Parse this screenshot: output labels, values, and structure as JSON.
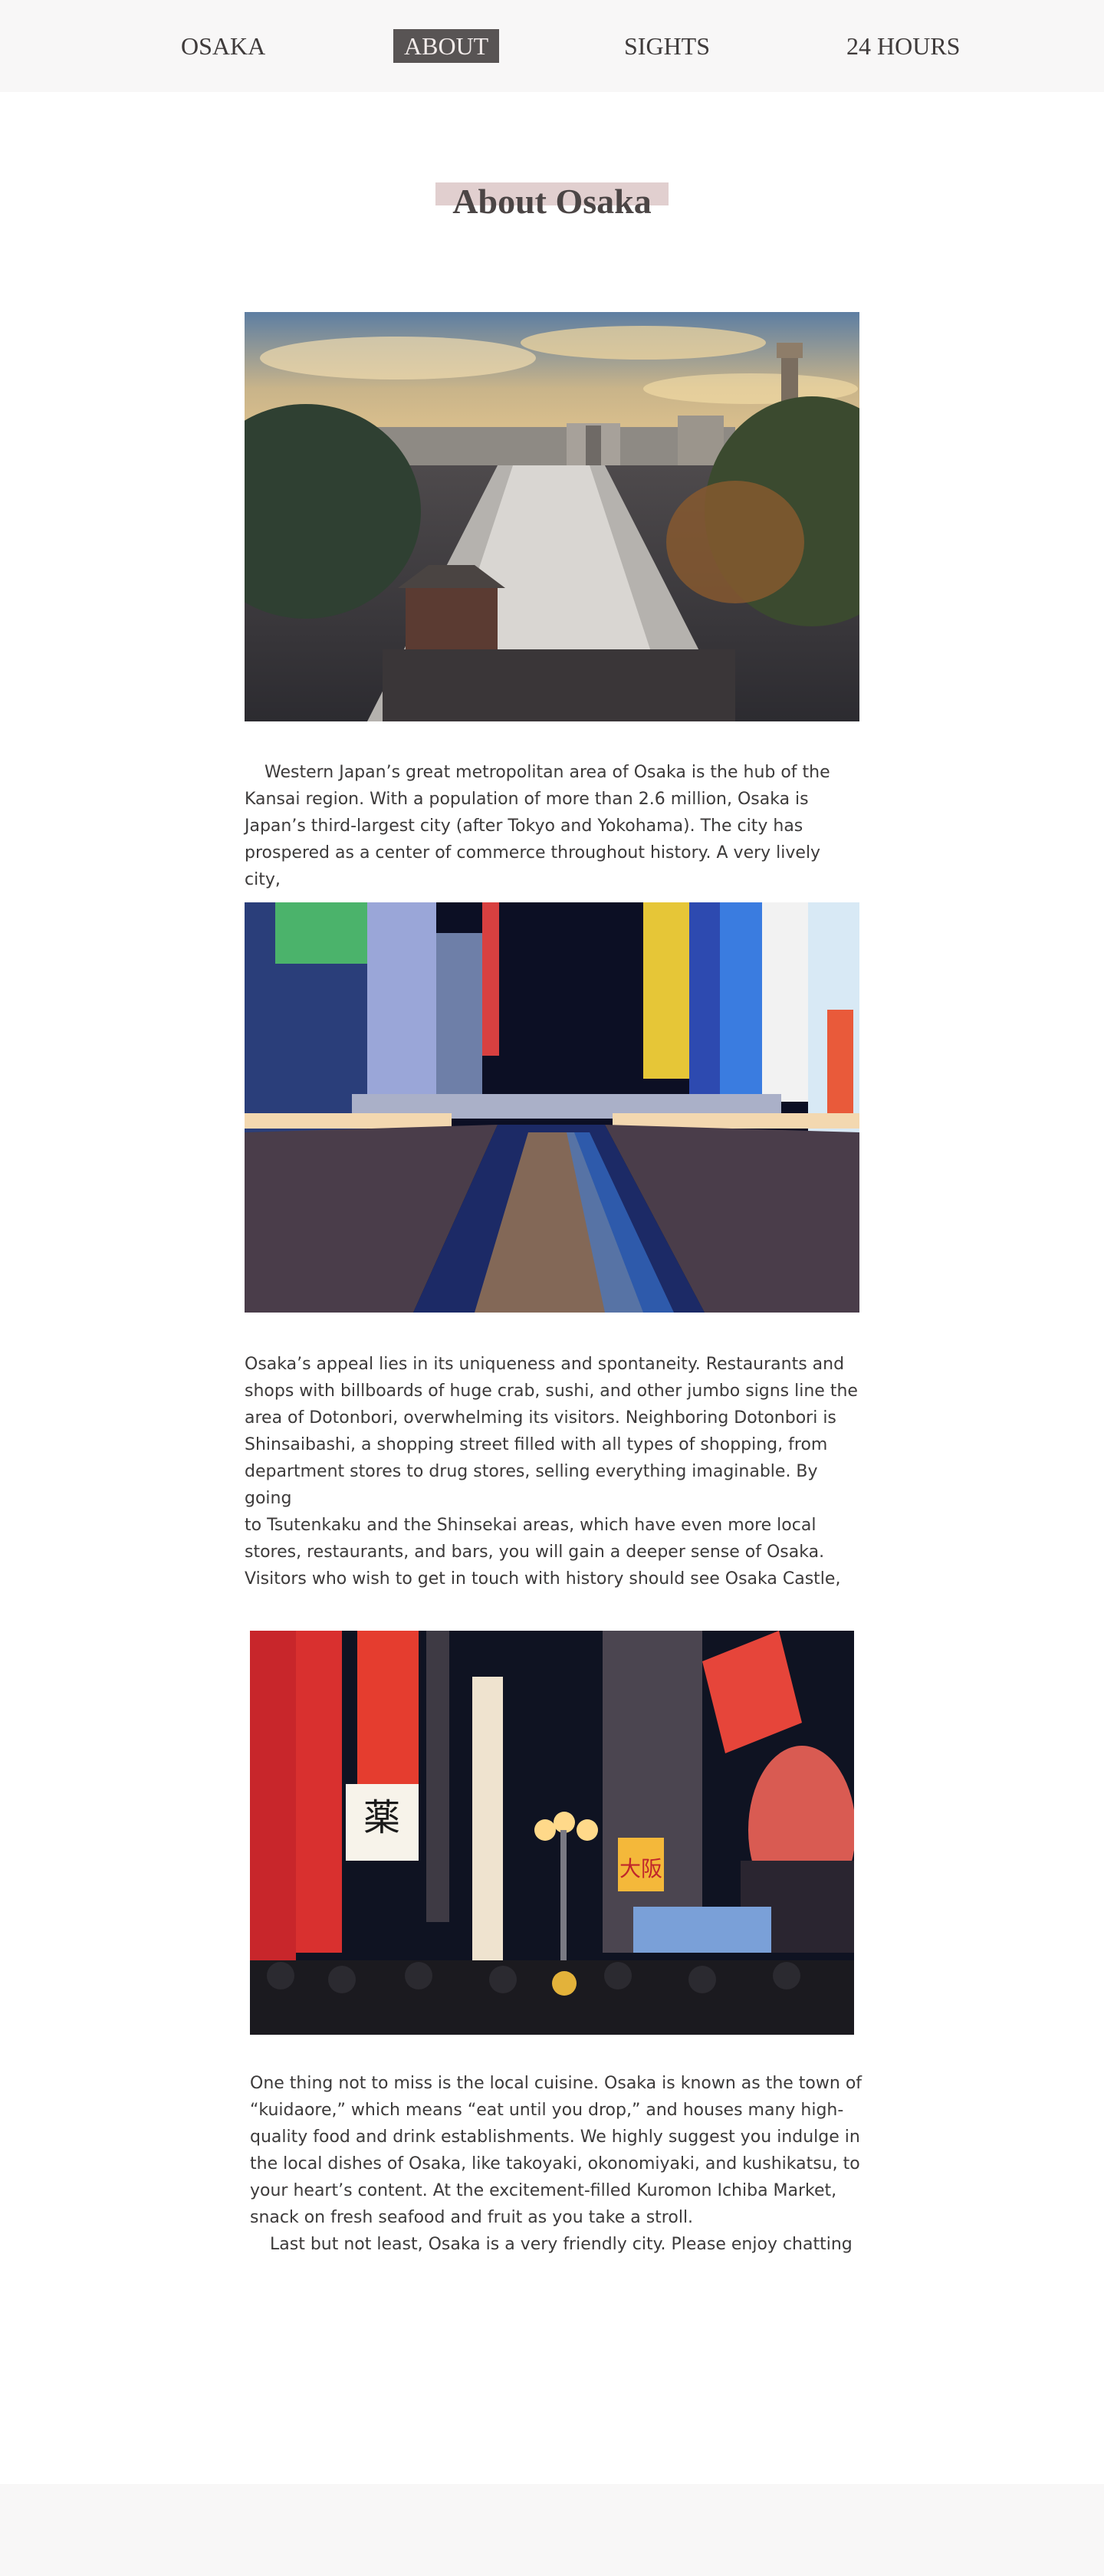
{
  "nav": {
    "items": [
      {
        "label": "OSAKA",
        "active": false
      },
      {
        "label": "ABOUT",
        "active": true
      },
      {
        "label": "SIGHTS",
        "active": false
      },
      {
        "label": "24 HOURS",
        "active": false
      }
    ]
  },
  "page": {
    "title": "About Osaka"
  },
  "sections": {
    "intro": {
      "lines": [
        "Western Japan’s great metropolitan area of Osaka is the hub of the",
        "Kansai region. With a population of more than 2.6 million, Osaka is",
        "Japan’s third-largest city (after Tokyo and Yokohama). The city has",
        "prospered as a center of commerce throughout history. A very lively city,"
      ]
    },
    "appeal": {
      "lines": [
        "Osaka’s appeal lies in its uniqueness and spontaneity. Restaurants and",
        "shops with billboards of huge crab, sushi, and other jumbo signs line the",
        "area of Dotonbori, overwhelming its visitors. Neighboring Dotonbori is",
        "Shinsaibashi, a shopping street filled with all types of shopping, from",
        "department stores to drug stores, selling everything imaginable. By going",
        "to Tsutenkaku and the Shinsekai areas, which have even more local",
        "stores, restaurants, and bars, you will gain a deeper sense of Osaka.",
        "Visitors who wish to get in touch with history should see Osaka Castle,"
      ]
    },
    "cuisine": {
      "lines": [
        "One thing not to miss is the local cuisine. Osaka is known as the town of",
        "“kuidaore,” which means “eat until you drop,” and houses many high-",
        "quality food and drink establishments. We highly suggest you indulge in",
        "the local dishes of Osaka, like takoyaki, okonomiyaki, and kushikatsu, to",
        "your heart’s content. At the excitement-filled Kuromon Ichiba Market,",
        "snack on fresh seafood and fruit as you take a stroll.",
        "Last but not least, Osaka is a very friendly city. Please enjoy chatting"
      ]
    }
  },
  "photos": {
    "shinsekai": {
      "icon": "tsutenkaku-tower-photo"
    },
    "dotonbori_canal": {
      "icon": "dotonbori-canal-photo"
    },
    "street_signs": {
      "icon": "street-signs-photo"
    },
    "street_signs_text": {
      "kusuri": "薬",
      "osaka": "大阪"
    }
  },
  "colors": {
    "nav_bg": "#f8f7f7",
    "nav_active_bg": "#585454",
    "title_highlight": "#e1cfcf",
    "text": "#3c3a3a"
  }
}
